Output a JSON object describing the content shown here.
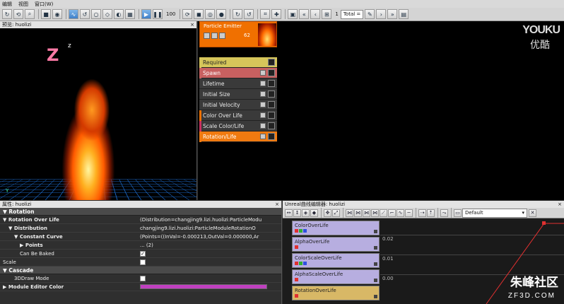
{
  "menu": {
    "items": [
      "编辑",
      "视图",
      "窗口(W)"
    ]
  },
  "toolbar": {
    "frame_counter": "100",
    "lod_index": "1",
    "lod_select": "Total ="
  },
  "preview": {
    "title": "预览: huolizi",
    "close": "×",
    "axis_label": "Y"
  },
  "emitter": {
    "name": "Particle Emitter",
    "count": "62",
    "modules": [
      {
        "label": "Required",
        "kind": "required",
        "stripe": "#d6c65a"
      },
      {
        "label": "Spawn",
        "kind": "spawn",
        "stripe": "#c86060"
      },
      {
        "label": "Lifetime",
        "kind": "normal",
        "stripe": ""
      },
      {
        "label": "Initial Size",
        "kind": "normal",
        "stripe": ""
      },
      {
        "label": "Initial Velocity",
        "kind": "normal",
        "stripe": ""
      },
      {
        "label": "Color Over Life",
        "kind": "normal",
        "stripe": "#f07000"
      },
      {
        "label": "Scale Color/Life",
        "kind": "normal",
        "stripe": "#c83060"
      },
      {
        "label": "Rotation/Life",
        "kind": "rotation",
        "stripe": "#f07a10"
      }
    ],
    "watermark_top": "YOUKU",
    "watermark_bottom": "优酷"
  },
  "properties": {
    "title": "属性: huolizi",
    "close": "×",
    "section_rotation": "Rotation",
    "rows": [
      {
        "name": "▼ Rotation Over Life",
        "value": "(Distribution=changjing9.lizi.huolizi:ParticleModu"
      },
      {
        "name": "▼ Distribution",
        "value": "changjing9.lizi.huolizi:ParticleModuleRotationO"
      },
      {
        "name": "▼ Constant Curve",
        "value": "(Points=((InVal=-0.000213,OutVal=0.000000,Ar"
      },
      {
        "name": "▶ Points",
        "value": "... (2)"
      },
      {
        "name": "Can Be Baked",
        "value": "✓"
      },
      {
        "name": "Scale",
        "value": ""
      }
    ],
    "section_cascade": "Cascade",
    "cascade_rows": [
      {
        "name": "3DDraw Mode",
        "value": ""
      },
      {
        "name": "▶ Module Editor Color",
        "value": ""
      }
    ]
  },
  "curve_editor": {
    "title": "Unreal曲线编辑器: huolizi",
    "close": "×",
    "preset": "Default",
    "tracks": [
      {
        "label": "ColorOverLife",
        "colors": [
          "#e03030",
          "#30b030",
          "#3050e0"
        ],
        "selected": false
      },
      {
        "label": "AlphaOverLife",
        "colors": [
          "#e03030"
        ],
        "selected": false
      },
      {
        "label": "ColorScaleOverLife",
        "colors": [
          "#e03030",
          "#30b030",
          "#3050e0"
        ],
        "selected": false
      },
      {
        "label": "AlphaScaleOverLife",
        "colors": [
          "#e03030"
        ],
        "selected": false
      },
      {
        "label": "RotationOverLife",
        "colors": [
          "#e03030"
        ],
        "selected": true
      }
    ],
    "y_ticks": [
      "0.02",
      "0.01",
      "0.00"
    ],
    "watermark_big": "朱峰社区",
    "watermark_small": "ZF3D.COM"
  }
}
